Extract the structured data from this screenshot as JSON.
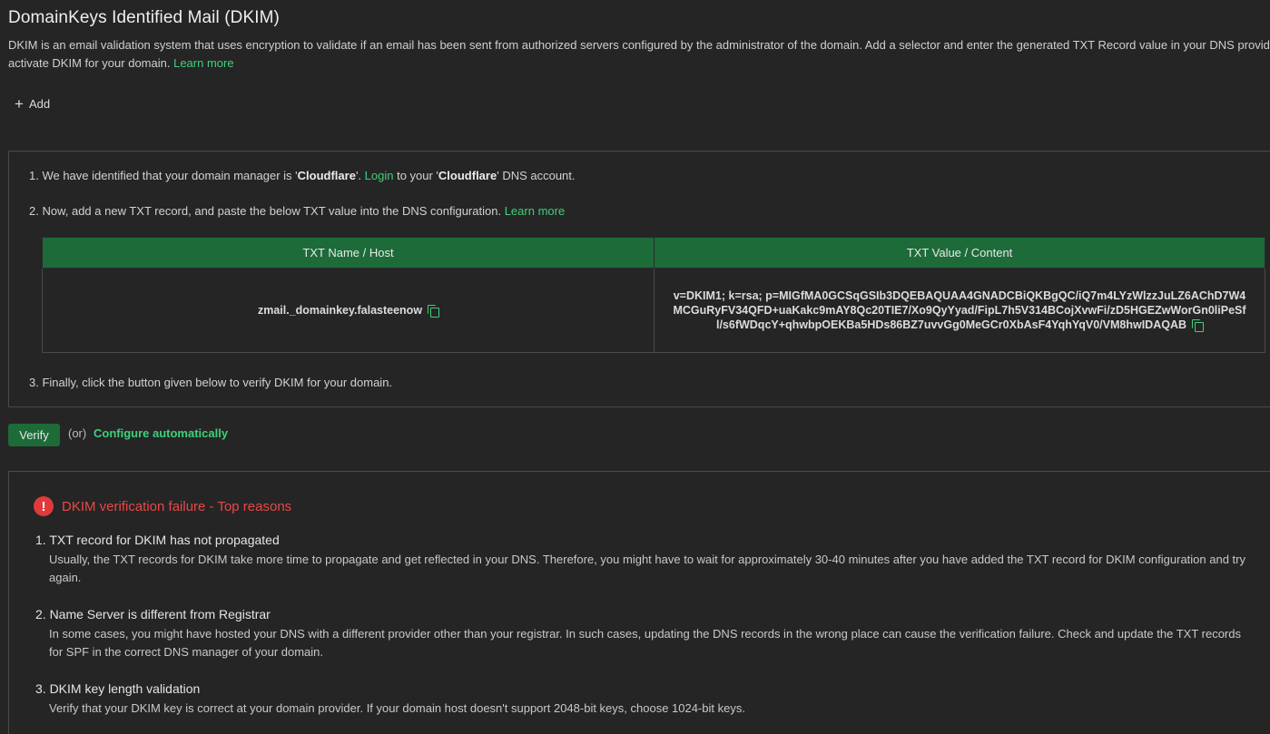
{
  "page": {
    "title": "DomainKeys Identified Mail (DKIM)",
    "description": "DKIM is an email validation system that uses encryption to validate if an email has been sent from authorized servers configured by the administrator of the domain. Add a selector and enter the generated TXT Record value in your DNS provider to activate DKIM for your domain.",
    "learn_more": "Learn more"
  },
  "toolbar": {
    "add_label": "Add",
    "add_icon": "plus-icon"
  },
  "steps": {
    "step1_prefix": "1. We have identified that your domain manager is '",
    "step1_provider": "Cloudflare",
    "step1_mid": "'. ",
    "step1_login": "Login",
    "step1_mid2": " to your '",
    "step1_provider2": "Cloudflare",
    "step1_suffix": "' DNS account.",
    "step2_text": "2. Now, add a new TXT record, and paste the below TXT value into the DNS configuration.",
    "step2_learn_more": "Learn more",
    "step3_text": "3. Finally, click the button given below to verify DKIM for your domain."
  },
  "dns_table": {
    "headers": [
      "TXT Name / Host",
      "TXT Value / Content"
    ],
    "name": "zmail._domainkey.falasteenow",
    "value": "v=DKIM1; k=rsa; p=MIGfMA0GCSqGSIb3DQEBAQUAA4GNADCBiQKBgQC/iQ7m4LYzWlzzJuLZ6AChD7W4MCGuRyFV34QFD+uaKakc9mAY8Qc20TIE7/Xo9QyYyad/FipL7h5V314BCojXvwFi/zD5HGEZwWorGn0liPeSfl/s6fWDqcY+qhwbpOEKBa5HDs86BZ7uvvGg0MeGCr0XbAsF4YqhYqV0/VM8hwIDAQAB",
    "copy_icon": "copy-icon"
  },
  "actions": {
    "verify_label": "Verify",
    "or_text": "(or)",
    "configure_label": "Configure automatically"
  },
  "failure": {
    "title": "DKIM verification failure - Top reasons",
    "icon": "alert-icon",
    "reasons": [
      {
        "title": "1. TXT record for DKIM has not propagated",
        "desc": "Usually, the TXT records for DKIM take more time to propagate and get reflected in your DNS. Therefore, you might have to wait for approximately 30-40 minutes after you have added the TXT record for DKIM configuration and try again."
      },
      {
        "title": "2. Name Server is different from Registrar",
        "desc": "In some cases, you might have hosted your DNS with a different provider other than your registrar. In such cases, updating the DNS records in the wrong place can cause the verification failure. Check and update the TXT records for SPF in the correct DNS manager of your domain."
      },
      {
        "title": "3. DKIM key length validation",
        "desc": "Verify that your DKIM key is correct at your domain provider. If your domain host doesn't support 2048-bit keys, choose 1024-bit keys."
      }
    ]
  },
  "colors": {
    "background": "#252525",
    "accent_green": "#3ed07b",
    "header_green": "#1d6b39",
    "error_red": "#e84848"
  }
}
